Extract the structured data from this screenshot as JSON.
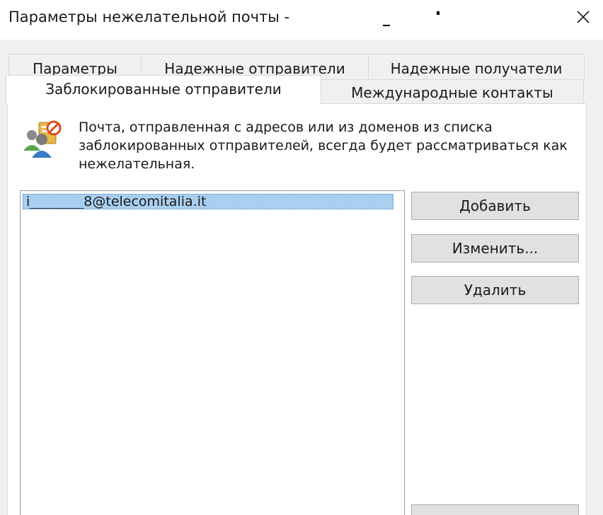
{
  "window": {
    "title": "Параметры нежелательной почты -"
  },
  "tabs": [
    {
      "label": "Параметры"
    },
    {
      "label": "Надежные отправители"
    },
    {
      "label": "Надежные получатели"
    },
    {
      "label": "Заблокированные отправители",
      "active": true
    },
    {
      "label": "Международные контакты"
    }
  ],
  "blocked": {
    "description": "Почта, отправленная с адресов или из доменов из списка заблокированных отправителей, всегда будет рассматриваться как нежелательная.",
    "list": [
      {
        "address": "i________8@telecomitalia.it",
        "selected": true
      }
    ],
    "buttons": {
      "add": "Добавить",
      "edit": "Изменить...",
      "remove": "Удалить"
    }
  },
  "icons": {
    "close": "close-icon",
    "blocked_senders": "blocked-senders-icon"
  },
  "colors": {
    "selection": "#a9cff0",
    "panel": "#ffffff",
    "dialog": "#f0f0f0"
  }
}
